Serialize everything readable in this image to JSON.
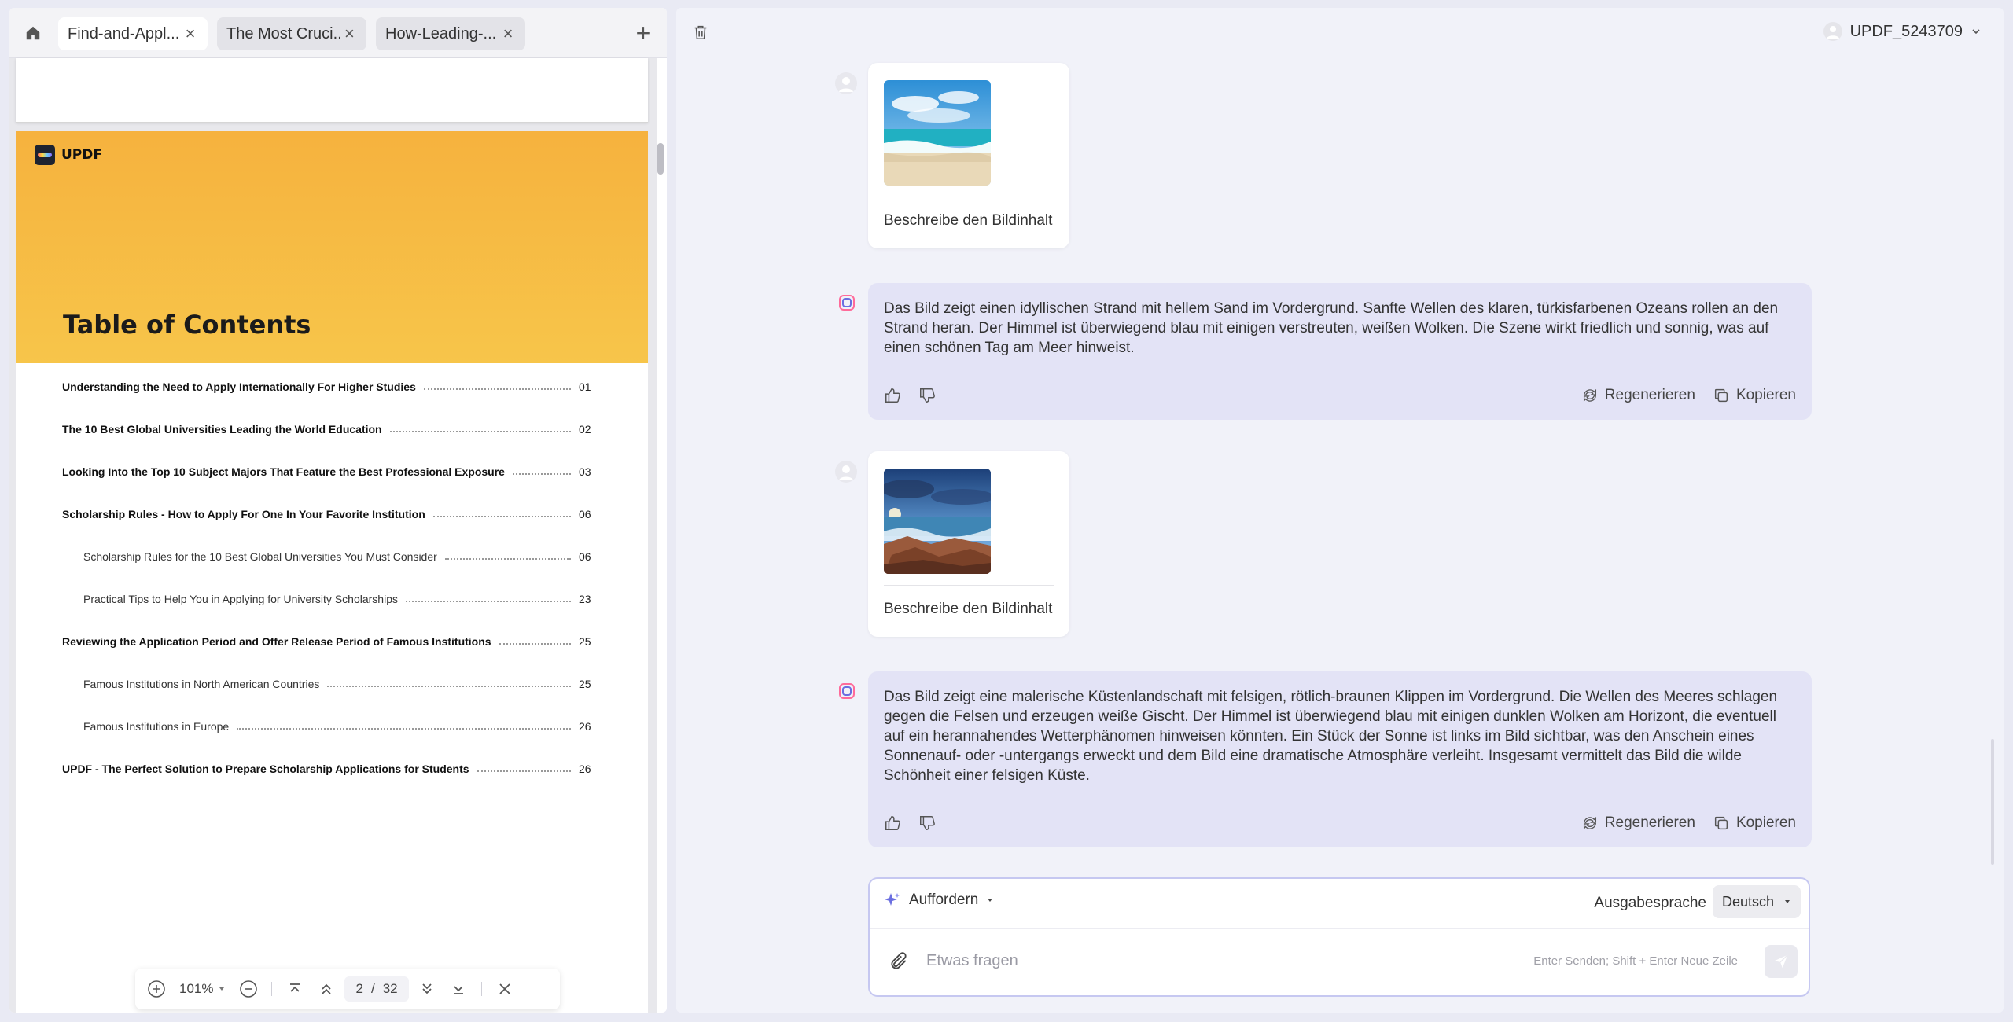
{
  "tabs": {
    "items": [
      {
        "label": "Find-and-Appl..."
      },
      {
        "label": "The Most Cruci..."
      },
      {
        "label": "How-Leading-..."
      }
    ],
    "close_glyph": "×",
    "new_tab_glyph": "+"
  },
  "document": {
    "brand": "UPDF",
    "toc_title": "Table of Contents",
    "toc": [
      {
        "text": "Understanding the Need to Apply Internationally For Higher Studies",
        "page": "01",
        "level": 1
      },
      {
        "text": "The 10 Best Global Universities Leading the World Education",
        "page": "02",
        "level": 1
      },
      {
        "text": "Looking Into the Top 10 Subject Majors That Feature the Best Professional Exposure",
        "page": "03",
        "level": 1
      },
      {
        "text": "Scholarship Rules - How to Apply For One In Your Favorite Institution",
        "page": "06",
        "level": 1
      },
      {
        "text": "Scholarship Rules for the 10 Best Global Universities You Must Consider",
        "page": "06",
        "level": 2
      },
      {
        "text": "Practical Tips to Help You in Applying for University Scholarships",
        "page": "23",
        "level": 2
      },
      {
        "text": "Reviewing the Application Period and Offer Release Period of Famous Institutions",
        "page": "25",
        "level": 1
      },
      {
        "text": "Famous Institutions in North American Countries",
        "page": "25",
        "level": 2
      },
      {
        "text": "Famous Institutions in Europe",
        "page": "26",
        "level": 2
      },
      {
        "text": "UPDF - The Perfect Solution to Prepare Scholarship Applications for Students",
        "page": "26",
        "level": 1
      }
    ]
  },
  "pdf_toolbar": {
    "zoom": "101%",
    "current_page": "2",
    "separator": "/",
    "total_pages": "32"
  },
  "chat": {
    "user_name": "UPDF_5243709",
    "messages": [
      {
        "role": "user",
        "caption": "Beschreibe den Bildinhalt",
        "image": "beach"
      },
      {
        "role": "assistant",
        "text": "Das Bild zeigt einen idyllischen Strand mit hellem Sand im Vordergrund. Sanfte Wellen des klaren, türkisfarbenen Ozeans rollen an den Strand heran. Der Himmel ist überwiegend blau mit einigen verstreuten, weißen Wolken. Die Szene wirkt friedlich und sonnig, was auf einen schönen Tag am Meer hinweist."
      },
      {
        "role": "user",
        "caption": "Beschreibe den Bildinhalt",
        "image": "rocky-coast"
      },
      {
        "role": "assistant",
        "text": "Das Bild zeigt eine malerische Küstenlandschaft mit felsigen, rötlich-braunen Klippen im Vordergrund. Die Wellen des Meeres schlagen gegen die Felsen und erzeugen weiße Gischt. Der Himmel ist überwiegend blau mit einigen dunklen Wolken am Horizont, die eventuell auf ein herannahendes Wetterphänomen hinweisen könnten. Ein Stück der Sonne ist links im Bild sichtbar, was den Anschein eines Sonnenauf- oder -untergangs erweckt und dem Bild eine dramatische Atmosphäre verleiht. Insgesamt vermittelt das Bild die wilde Schönheit einer felsigen Küste."
      }
    ],
    "actions": {
      "regenerate": "Regenerieren",
      "copy": "Kopieren"
    },
    "composer": {
      "prompt_label": "Auffordern",
      "output_language_label": "Ausgabesprache",
      "language": "Deutsch",
      "placeholder": "Etwas fragen",
      "hint": "Enter Senden; Shift + Enter Neue Zeile"
    }
  },
  "colors": {
    "accent": "#6b6fe0",
    "ai_bubble": "#e3e3f6",
    "page_header": "#f6b23e"
  }
}
